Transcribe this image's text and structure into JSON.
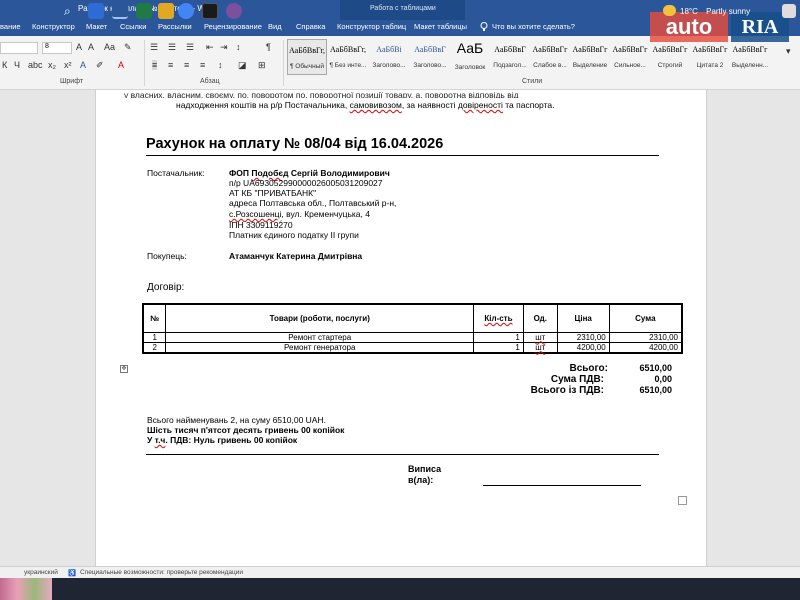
{
  "window": {
    "doc_title": "Рахунок на оплату №8 квітень - Word",
    "context_group": "Работа с таблицами"
  },
  "ribbon_tabs": [
    "вание",
    "Конструктор",
    "Макет",
    "Ссылки",
    "Рассылки",
    "Рецензирование",
    "Вид",
    "Справка",
    "Конструктор таблиц",
    "Макет таблицы",
    "Что вы хотите сделать?"
  ],
  "ribbon": {
    "font_size": "8",
    "group_labels": {
      "font": "Шрифт",
      "paragraph": "Абзац",
      "styles": "Стили"
    },
    "styles": [
      {
        "sample": "АаБбВвГг,",
        "name": "¶ Обычный"
      },
      {
        "sample": "АаБбВвГг,",
        "name": "¶ Без инте..."
      },
      {
        "sample": "АаБбВі",
        "name": "Заголово..."
      },
      {
        "sample": "АаБбВвГ",
        "name": "Заголово..."
      },
      {
        "sample": "АаБ",
        "name": "Заголовок"
      },
      {
        "sample": "АаБбВвГ",
        "name": "Подзагол..."
      },
      {
        "sample": "АаБбВвГг",
        "name": "Слабое в..."
      },
      {
        "sample": "АаБбВвГг",
        "name": "Выделение"
      },
      {
        "sample": "АаБбВвГг",
        "name": "Сильное..."
      },
      {
        "sample": "АаБбВвГг",
        "name": "Строгий"
      },
      {
        "sample": "АаБбВвГг",
        "name": "Цитата 2"
      },
      {
        "sample": "АаБбВвГг",
        "name": "Выделенн..."
      }
    ]
  },
  "watermark": {
    "left": "auto",
    "right": "RIA"
  },
  "document": {
    "top_cut_line": "у власних, власним, своєму, по, поворотом по, поворотної позиції товару, а, поворотна відповідь від",
    "top_line2_prefix": "надходження коштів на р/р Постачальника, ",
    "top_line2_samovyvoz": "самовивозом",
    "top_line2_mid": ", за наявності ",
    "top_line2_dov": "довіреності",
    "top_line2_suffix": " та паспорта.",
    "invoice_title": "Рахунок на оплату № 08/04 від 16.04.2026",
    "supplier_label": "Постачальник:",
    "supplier_name_pre": "ФОП ",
    "supplier_name_ul": "Подобєд",
    "supplier_name_post": " Сергій Володимирович",
    "supplier_lines": [
      "п/р UA693052990000026005031209027",
      "АТ КБ \"ПРИВАТБАНК\"",
      "адреса Полтавська обл., Полтавський р-н,",
      "",
      " ІПН 3309119270",
      "Платник єдиного податку ІІ групи"
    ],
    "supplier_village": "с.Розсошенці",
    "supplier_street": ", вул. Кременчуцька, 4",
    "buyer_label": "Покупець:",
    "buyer_name": "Атаманчук Катерина Дмитрівна",
    "contract_label": "Договір:",
    "table": {
      "headers": [
        "№",
        "Товари (роботи, послуги)",
        "Кіл-сть",
        "Од.",
        "Ціна",
        "Сума"
      ],
      "rows": [
        [
          "1",
          "Ремонт стартера",
          "1",
          "шт",
          "2310,00",
          "2310,00"
        ],
        [
          "2",
          "Ремонт генератора",
          "1",
          "шт",
          "4200,00",
          "4200,00"
        ]
      ]
    },
    "totals": {
      "total_label": "Всього:",
      "total_value": "6510,00",
      "vat_label": "Сума ПДВ:",
      "vat_value": "0,00",
      "grand_label": "Всього із ПДВ:",
      "grand_value": "6510,00"
    },
    "summary_line1": "Всього найменувань 2, на суму 6510,00 UAH.",
    "summary_line2": "Шість тисяч п'ятсот десять гривень 00 копійок",
    "summary_line3_pre": "У ",
    "summary_line3_ul": "т.ч",
    "summary_line3_post": ". ПДВ: Нуль гривень 00 копійок",
    "signature_label_1": "Виписа",
    "signature_label_2": "в(ла):"
  },
  "statusbar": {
    "language": "украинский",
    "accessibility": "Специальные возможности: проверьте рекомендации"
  },
  "taskbar": {
    "temperature": "18°C",
    "weather": "Partly sunny"
  }
}
